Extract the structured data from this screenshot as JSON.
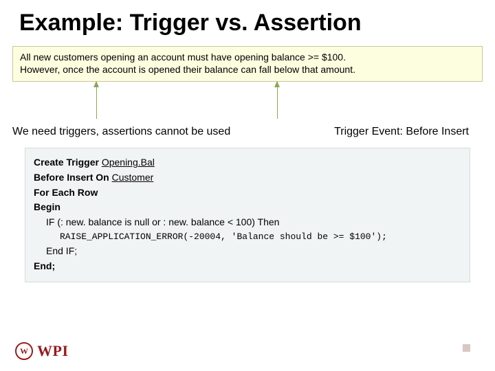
{
  "title": "Example: Trigger vs. Assertion",
  "rule": {
    "line1": "All new customers opening an account must have opening balance >= $100.",
    "line2": "However, once the account is opened their balance can fall below that amount."
  },
  "annot": {
    "left": "We need triggers, assertions cannot be used",
    "right": "Trigger Event: Before Insert"
  },
  "code": {
    "l1a": "Create Trigger ",
    "l1b": "Opening.Bal",
    "l2a": "Before Insert On ",
    "l2b": "Customer",
    "l3": "For Each Row",
    "l4": "Begin",
    "l5": "IF (: new. balance is null or : new. balance < 100) Then",
    "l6": "RAISE_APPLICATION_ERROR(-20004,  'Balance should be >= $100');",
    "l7": "End IF;",
    "l8": "End;"
  },
  "logo": {
    "seal_text": "W",
    "text": "WPI"
  }
}
